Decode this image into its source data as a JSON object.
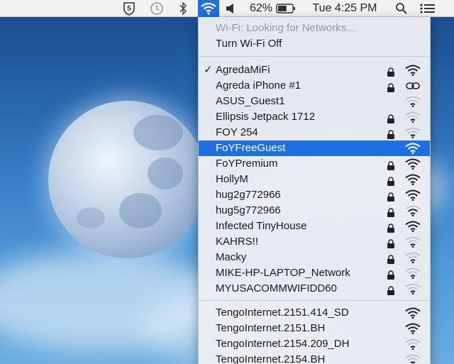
{
  "menubar": {
    "items": [
      {
        "name": "badge-5-icon",
        "glyph": "5"
      },
      {
        "name": "time-machine-icon",
        "glyph": "⟲"
      },
      {
        "name": "bluetooth-icon",
        "glyph": "ᛒ"
      },
      {
        "name": "wifi-icon",
        "glyph": ""
      },
      {
        "name": "volume-icon",
        "glyph": "◀"
      }
    ],
    "battery_percent": "62%",
    "battery_level": 0.62,
    "clock": "Tue 4:25 PM",
    "search_glyph": "⌕",
    "list_glyph": "☰",
    "accent": "#1f6fe0"
  },
  "wifi_menu": {
    "status": "Wi-Fi: Looking for Networks...",
    "toggle": "Turn Wi-Fi Off",
    "networks": [
      {
        "name": "AgredaMiFi",
        "check": "✓",
        "locked": true,
        "signal": 3,
        "hotspot": false,
        "selected": false
      },
      {
        "name": "Agreda iPhone #1",
        "check": "",
        "locked": true,
        "signal": 0,
        "hotspot": true,
        "selected": false
      },
      {
        "name": "ASUS_Guest1",
        "check": "",
        "locked": false,
        "signal": 1,
        "hotspot": false,
        "selected": false
      },
      {
        "name": "Ellipsis Jetpack 1712",
        "check": "",
        "locked": true,
        "signal": 1,
        "hotspot": false,
        "selected": false
      },
      {
        "name": "FOY 254",
        "check": "",
        "locked": true,
        "signal": 1,
        "hotspot": false,
        "selected": false
      },
      {
        "name": "FoYFreeGuest",
        "check": "",
        "locked": false,
        "signal": 3,
        "hotspot": false,
        "selected": true
      },
      {
        "name": "FoYPremium",
        "check": "",
        "locked": true,
        "signal": 3,
        "hotspot": false,
        "selected": false
      },
      {
        "name": "HollyM",
        "check": "",
        "locked": true,
        "signal": 3,
        "hotspot": false,
        "selected": false
      },
      {
        "name": "hug2g772966",
        "check": "",
        "locked": true,
        "signal": 3,
        "hotspot": false,
        "selected": false
      },
      {
        "name": "hug5g772966",
        "check": "",
        "locked": true,
        "signal": 2,
        "hotspot": false,
        "selected": false
      },
      {
        "name": "Infected TinyHouse",
        "check": "",
        "locked": true,
        "signal": 3,
        "hotspot": false,
        "selected": false
      },
      {
        "name": "KAHRS!!",
        "check": "",
        "locked": true,
        "signal": 1,
        "hotspot": false,
        "selected": false
      },
      {
        "name": "Macky",
        "check": "",
        "locked": true,
        "signal": 1,
        "hotspot": false,
        "selected": false
      },
      {
        "name": "MIKE-HP-LAPTOP_Network",
        "check": "",
        "locked": true,
        "signal": 1,
        "hotspot": false,
        "selected": false
      },
      {
        "name": "MYUSACOMMWIFIDD60",
        "check": "",
        "locked": true,
        "signal": 1,
        "hotspot": false,
        "selected": false
      }
    ],
    "open_networks": [
      {
        "name": "TengoInternet.2151.414_SD",
        "signal": 3
      },
      {
        "name": "TengoInternet.2151.BH",
        "signal": 3
      },
      {
        "name": "TengoInternet.2154.209_DH",
        "signal": 1
      },
      {
        "name": "TengoInternet.2154.BH",
        "signal": 1
      }
    ]
  }
}
